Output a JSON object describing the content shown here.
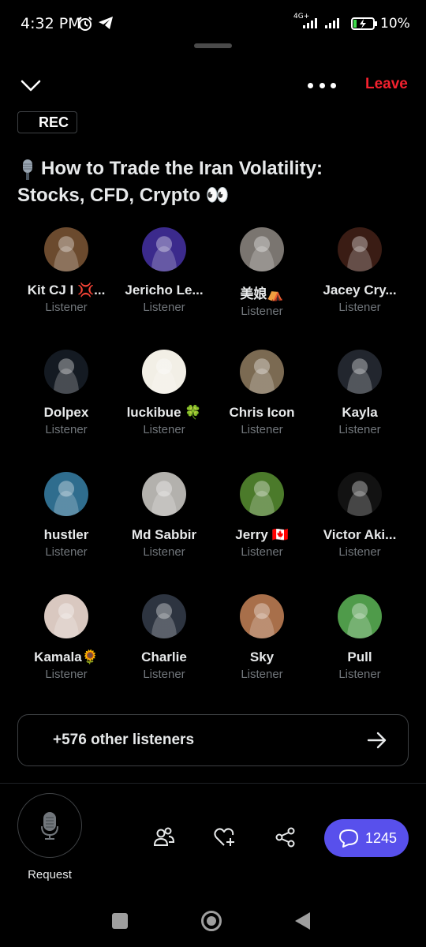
{
  "status_bar": {
    "time": "4:32 PM",
    "network_label_top": "4G+",
    "network_label_bottom": "4Ⅱ",
    "battery": "10%",
    "icons": [
      "alarm-icon",
      "telegram-icon",
      "signal-icon",
      "signal-icon",
      "battery-charging-icon"
    ]
  },
  "header": {
    "leave_label": "Leave",
    "leave_color": "#f4212e",
    "more_icon": "more-dots-icon",
    "collapse_icon": "chevron-down-icon"
  },
  "rec": {
    "label": "REC"
  },
  "space": {
    "title_line1": "How to Trade the Iran Volatility:",
    "title_line2": "Stocks, CFD, Crypto 👀",
    "title_icon": "microphone-emoji"
  },
  "listeners": [
    {
      "name": "Kit CJ I 💢...",
      "role": "Listener",
      "avatar_icon": "cartoon-cowboy-avatar",
      "avatar_bg": "#6b4a2e"
    },
    {
      "name": "Jericho Le...",
      "role": "Listener",
      "avatar_icon": "blue-wizard-nft-avatar",
      "avatar_bg": "#3b2a8c"
    },
    {
      "name": "美娘⛺",
      "role": "Listener",
      "avatar_icon": "hand-figurine-avatar",
      "avatar_bg": "#7a7570"
    },
    {
      "name": "Jacey Cry...",
      "role": "Listener",
      "avatar_icon": "fire-ring-avatar",
      "avatar_bg": "#3a1c14"
    },
    {
      "name": "Dolpex",
      "role": "Listener",
      "avatar_icon": "phone-screen-avatar",
      "avatar_bg": "#141a22"
    },
    {
      "name": "luckibue 🍀",
      "role": "Listener",
      "avatar_icon": "anime-girl-avatar",
      "avatar_bg": "#f2efe6"
    },
    {
      "name": "Chris Icon",
      "role": "Listener",
      "avatar_icon": "los-angeles-shirt-avatar",
      "avatar_bg": "#7b6a52"
    },
    {
      "name": "Kayla",
      "role": "Listener",
      "avatar_icon": "car-lights-avatar",
      "avatar_bg": "#22262e"
    },
    {
      "name": "hustler",
      "role": "Listener",
      "avatar_icon": "masked-hero-avatar",
      "avatar_bg": "#2f6d8e"
    },
    {
      "name": "Md Sabbir",
      "role": "Listener",
      "avatar_icon": "man-portrait-avatar",
      "avatar_bg": "#b3b1ad"
    },
    {
      "name": "Jerry 🇨🇦",
      "role": "Listener",
      "avatar_icon": "golf-driver-avatar",
      "avatar_bg": "#4b7a2a"
    },
    {
      "name": "Victor Aki...",
      "role": "Listener",
      "avatar_icon": "app-logo-avatar",
      "avatar_bg": "#121212"
    },
    {
      "name": "Kamala🌻",
      "role": "Listener",
      "avatar_icon": "woman-portrait-avatar",
      "avatar_bg": "#d9c8c0"
    },
    {
      "name": "Charlie",
      "role": "Listener",
      "avatar_icon": "suit-man-avatar",
      "avatar_bg": "#2d3440"
    },
    {
      "name": "Sky",
      "role": "Listener",
      "avatar_icon": "street-photo-avatar",
      "avatar_bg": "#a86f4a"
    },
    {
      "name": "Pull",
      "role": "Listener",
      "avatar_icon": "cartoon-boy-avatar",
      "avatar_bg": "#4f9b4a"
    }
  ],
  "others": {
    "label": "+576 other listeners",
    "icon": "arrow-right-icon"
  },
  "bottom_bar": {
    "request_label": "Request",
    "request_icon": "microphone-icon",
    "people_icon": "people-icon",
    "heart_icon": "heart-plus-icon",
    "share_icon": "share-icon",
    "comments_count": "1245",
    "comments_icon": "comment-icon",
    "comments_color": "#5850ec"
  },
  "nav_bar": {
    "icons": [
      "recents-icon",
      "home-icon",
      "back-icon"
    ]
  }
}
